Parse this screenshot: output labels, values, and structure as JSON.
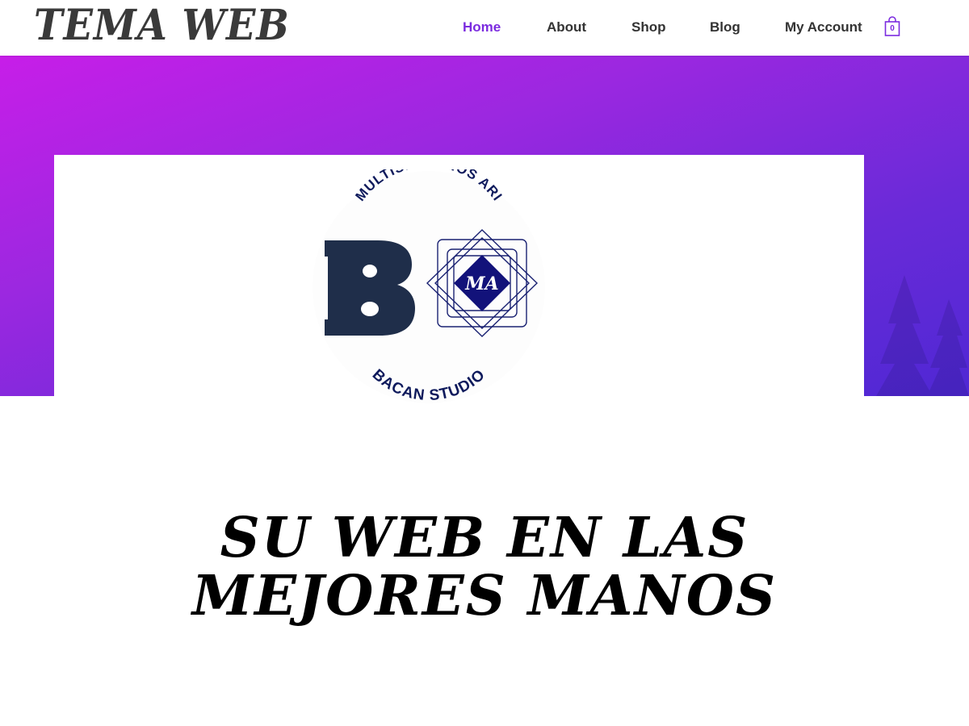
{
  "header": {
    "site_title": "TEMA WEB",
    "nav": [
      {
        "label": "Home",
        "active": true
      },
      {
        "label": "About",
        "active": false
      },
      {
        "label": "Shop",
        "active": false
      },
      {
        "label": "Blog",
        "active": false
      },
      {
        "label": "My Account",
        "active": false
      }
    ],
    "cart": {
      "count": "0",
      "icon": "shopping-bag-icon"
    }
  },
  "hero": {
    "logo": {
      "top_text": "MULTISERVICIOS ARI",
      "bottom_text": "BACAN STUDIO",
      "left_letter": "B",
      "emblem_text": "MA"
    },
    "colors": {
      "gradient_start": "#c71ee8",
      "gradient_end": "#4f28d4",
      "accent": "#7b2bdf"
    }
  },
  "main": {
    "headline_line1": "SU WEB EN LAS",
    "headline_line2": "MEJORES MANOS"
  }
}
